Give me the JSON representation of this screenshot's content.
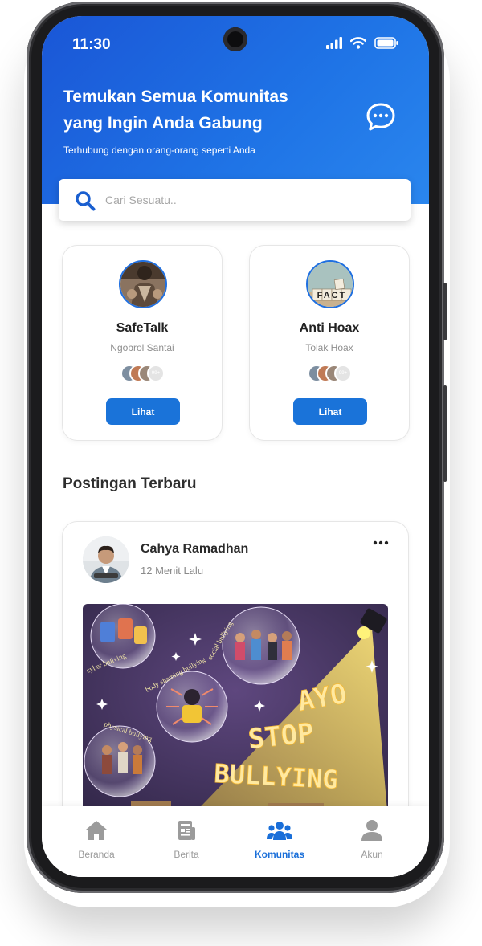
{
  "status_bar": {
    "time": "11:30"
  },
  "header": {
    "title_line1": "Temukan Semua Komunitas",
    "title_line2": "yang Ingin Anda Gabung",
    "subtitle": "Terhubung dengan orang-orang seperti Anda"
  },
  "search": {
    "placeholder": "Cari Sesuatu.."
  },
  "communities": [
    {
      "name": "SafeTalk",
      "tagline": "Ngobrol Santai",
      "members_extra": "99+",
      "button_label": "Lihat"
    },
    {
      "name": "Anti Hoax",
      "tagline": "Tolak Hoax",
      "members_extra": "99+",
      "button_label": "Lihat"
    }
  ],
  "latest_posts": {
    "title": "Postingan Terbaru",
    "posts": [
      {
        "author": "Cahya Ramadhan",
        "time": "12 Menit Lalu"
      }
    ]
  },
  "poster": {
    "line1": "AYO",
    "line2": "STOP",
    "line3": "BULLYING",
    "labels": [
      "cyber bullying",
      "social bullying",
      "body shaming bullying",
      "physical bullying"
    ]
  },
  "avatar_text": {
    "fact": "FACT"
  },
  "bottom_nav": [
    {
      "label": "Beranda",
      "icon": "home-icon",
      "active": false
    },
    {
      "label": "Berita",
      "icon": "news-icon",
      "active": false
    },
    {
      "label": "Komunitas",
      "icon": "community-icon",
      "active": true
    },
    {
      "label": "Akun",
      "icon": "account-icon",
      "active": false
    }
  ],
  "colors": {
    "primary": "#1a73d9",
    "header_gradient_start": "#1a56d6",
    "header_gradient_end": "#2a86ee",
    "nav_active": "#1a6fd9",
    "nav_inactive": "#9b9b9b"
  }
}
